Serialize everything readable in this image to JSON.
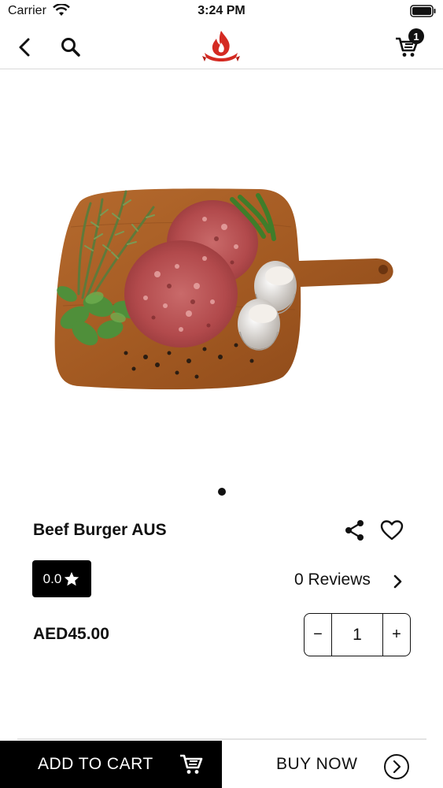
{
  "status_bar": {
    "carrier": "Carrier",
    "time": "3:24 PM"
  },
  "nav": {
    "cart_count": "1",
    "icons": [
      "chevron-left-icon",
      "search-icon",
      "flame-logo",
      "cart-icon"
    ]
  },
  "product": {
    "name": "Beef Burger AUS",
    "rating": "0.0",
    "reviews_label": "0 Reviews",
    "price": "AED45.00",
    "quantity": "1",
    "image_pages": 1,
    "current_page": 1
  },
  "stepper": {
    "minus_label": "−",
    "plus_label": "+"
  },
  "actions": {
    "add_to_cart_label": "ADD TO CART",
    "buy_now_label": "BUY NOW"
  },
  "colors": {
    "accent": "#000000",
    "logo_red": "#d42a22",
    "background": "#ffffff"
  }
}
